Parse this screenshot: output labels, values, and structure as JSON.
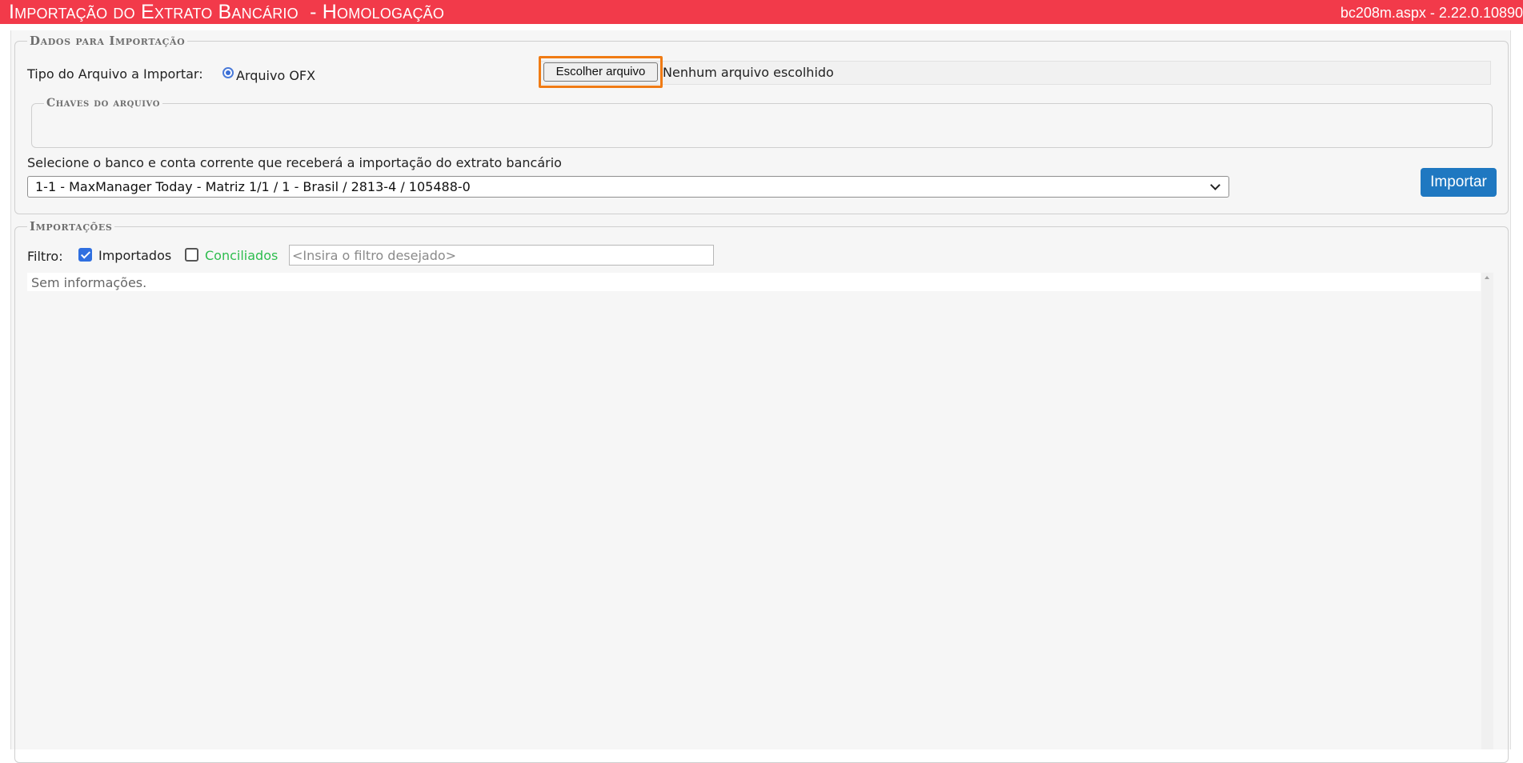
{
  "header": {
    "title": "Importação do Extrato Bancário  - Homologação",
    "version": "bc208m.aspx - 2.22.0.10890"
  },
  "dados": {
    "legend": "Dados para Importação",
    "tipo_label": "Tipo do Arquivo a Importar:",
    "radio_label": "Arquivo OFX",
    "file_button": "Escolher arquivo",
    "file_status": "Nenhum arquivo escolhido",
    "chaves_legend": "Chaves do arquivo",
    "select_label": "Selecione o banco e conta corrente que receberá a importação do extrato bancário",
    "select_value": "1-1 - MaxManager Today - Matriz 1/1 / 1 - Brasil / 2813-4 / 105488-0",
    "import_button": "Importar"
  },
  "importacoes": {
    "legend": "Importações",
    "filter_label": "Filtro:",
    "importados_label": "Importados",
    "importados_checked": true,
    "conciliados_label": "Conciliados",
    "conciliados_checked": false,
    "conciliados_color": "#2ebd4e",
    "filter_placeholder": "<Insira o filtro desejado>",
    "empty_message": "Sem informações."
  },
  "colors": {
    "header_bg": "#f23a4a",
    "accent_blue": "#1f78c1",
    "focus_orange": "#f07b14"
  }
}
